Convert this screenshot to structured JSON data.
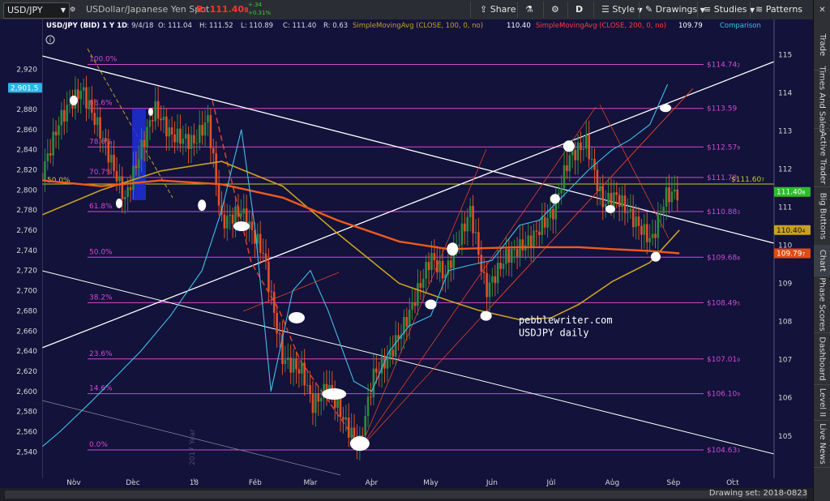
{
  "toolbar": {
    "symbol": "USD/JPY",
    "symbol_desc": "USDollar/Japanese Yen Spot",
    "bid_label": "B: 111.40",
    "bid_sub": "8",
    "change_top": "+.34",
    "change_bottom": "+0.31%",
    "share": "Share",
    "period": "D",
    "style": "Style",
    "drawings": "Drawings",
    "studies": "Studies",
    "patterns": "Patterns"
  },
  "icons": {
    "symbol_dropdown": "chevron-down-icon",
    "share": "share-icon",
    "flask": "flask-icon",
    "gear": "gear-icon",
    "style": "style-icon",
    "drawings": "pencil-icon",
    "studies": "studies-icon",
    "patterns": "patterns-icon",
    "close": "close-icon",
    "info": "info-icon"
  },
  "sidebar": [
    "Trade",
    "Times And Sales",
    "Active Trader",
    "Big Buttons",
    "Chart",
    "Phase Scores",
    "Dashboard",
    "Level II",
    "Live News"
  ],
  "statusbar": {
    "drawing_set": "Drawing set: 2018-0823"
  },
  "colors": {
    "background": "#12123a",
    "price_candle_up": "#2e8b3a",
    "price_candle_down": "#e0502a",
    "sma100": "#c8a21e",
    "sma200": "#f05a1a",
    "cyan_overlay": "#3fc0e8",
    "fib_lines": "#d24ad2",
    "trend_lines": "#ffffff",
    "price_badge": "#2dbb2d"
  },
  "chart_data": {
    "type": "line",
    "header": {
      "title": "USD/JPY (BID) 1 Y 1D",
      "date": "D: 9/4/18",
      "open": "O: 111.04",
      "high": "H: 111.52",
      "low": "L: 110.89",
      "close": "C: 111.40",
      "range": "R: 0.63",
      "sma100_label": "SimpleMovingAvg (CLOSE, 100, 0, no)",
      "sma100_value": "110.40",
      "sma200_label": "SimpleMovingAvg (CLOSE, 200, 0, no)",
      "sma200_value": "109.79",
      "comparison": "Comparison"
    },
    "x_ticks": [
      "Nov",
      "Dec",
      "18",
      "Feb",
      "Mar",
      "Apr",
      "May",
      "Jun",
      "Jul",
      "Aug",
      "Sep",
      "Oct"
    ],
    "right_axis": {
      "ticks": [
        105,
        106,
        107,
        108,
        109,
        110,
        111,
        112,
        113,
        114,
        115
      ],
      "range": [
        104.4,
        115.2
      ]
    },
    "left_axis": {
      "ticks": [
        2540,
        2560,
        2580,
        2600,
        2620,
        2640,
        2660,
        2680,
        2700,
        2720,
        2740,
        2760,
        2780,
        2800,
        2820,
        2840,
        2860,
        2880,
        2900,
        2920
      ],
      "tick_labels": [
        "2,540",
        "2,560",
        "2,580",
        "2,600",
        "2,620",
        "2,640",
        "2,660",
        "2,680",
        "2,700",
        "2,720",
        "2,740",
        "2,760",
        "2,780",
        "2,800",
        "2,820",
        "2,840",
        "2,860",
        "2,880",
        "2,900",
        "2,920"
      ],
      "range": [
        2533,
        2942
      ]
    },
    "fib_levels": [
      {
        "pct": "100.0%",
        "price": "$114.74",
        "price_sub": "2",
        "value": 114.742
      },
      {
        "pct": "88.6%",
        "price": "$113.59",
        "price_sub": "",
        "value": 113.59
      },
      {
        "pct": "78.6%",
        "price": "$112.57",
        "price_sub": "9",
        "value": 112.579
      },
      {
        "pct": "70.7%",
        "price": "$111.78",
        "price_sub": "",
        "value": 111.78
      },
      {
        "pct": "61.8%",
        "price": "$110.88",
        "price_sub": "3",
        "value": 110.883
      },
      {
        "pct": "50.0%",
        "price": "$109.68",
        "price_sub": "8",
        "value": 109.688
      },
      {
        "pct": "38.2%",
        "price": "$108.49",
        "price_sub": "5",
        "value": 108.495
      },
      {
        "pct": "23.6%",
        "price": "$107.01",
        "price_sub": "9",
        "value": 107.019
      },
      {
        "pct": "14.6%",
        "price": "$106.10",
        "price_sub": "9",
        "value": 106.109
      },
      {
        "pct": "0.0%",
        "price": "$104.63",
        "price_sub": "3",
        "value": 104.633
      }
    ],
    "badges": [
      {
        "text": "2,901.5",
        "axis": "left",
        "value": 2901.5,
        "bg": "#29b6e8",
        "fg": "#ffffff"
      },
      {
        "text": "111.40",
        "sub": "8",
        "axis": "right",
        "value": 111.4,
        "bg": "#2dbb2d",
        "fg": "#ffffff"
      },
      {
        "text": "110.40",
        "sub": "4",
        "axis": "right",
        "value": 110.4,
        "bg": "#c8a21e",
        "fg": "#111111"
      },
      {
        "text": "109.79",
        "sub": "7",
        "axis": "right",
        "value": 109.79,
        "bg": "#e24a14",
        "fg": "#ffffff"
      }
    ],
    "horizontal_lines": [
      {
        "label": "50.0%",
        "price_label": "$111.60",
        "price_sub": "7",
        "value": 111.607,
        "color": "#c9c930"
      }
    ],
    "annotations": [
      {
        "text": "pebblewriter.com",
        "x_date": "2018-07-01",
        "y": 107.95
      },
      {
        "text": "USDJPY daily",
        "x_date": "2018-07-01",
        "y": 107.62
      },
      {
        "text": "2017 Year",
        "x_date": "2018-01-01",
        "y": 104.9
      }
    ],
    "series": [
      {
        "name": "SimpleMovingAvg (CLOSE, 100, 0, no)",
        "color": "#c8a21e",
        "x": [
          "2017-10-16",
          "2017-11-15",
          "2017-12-15",
          "2018-01-15",
          "2018-02-15",
          "2018-03-15",
          "2018-04-15",
          "2018-05-10",
          "2018-05-25",
          "2018-06-15",
          "2018-07-01",
          "2018-07-15",
          "2018-08-01",
          "2018-08-20",
          "2018-09-04"
        ],
        "y": [
          110.8,
          111.45,
          111.95,
          112.2,
          111.55,
          110.3,
          109.0,
          108.55,
          108.3,
          108.05,
          108.1,
          108.45,
          109.05,
          109.55,
          110.4
        ]
      },
      {
        "name": "SimpleMovingAvg (CLOSE, 200, 0, no)",
        "color": "#f05a1a",
        "x": [
          "2017-10-16",
          "2017-11-15",
          "2017-12-15",
          "2018-01-15",
          "2018-02-15",
          "2018-03-15",
          "2018-04-15",
          "2018-05-10",
          "2018-06-15",
          "2018-07-15",
          "2018-08-01",
          "2018-08-20",
          "2018-09-04"
        ],
        "y": [
          111.7,
          111.55,
          111.7,
          111.6,
          111.25,
          110.65,
          110.1,
          109.9,
          109.95,
          109.95,
          109.9,
          109.85,
          109.79
        ]
      },
      {
        "name": "Comparison",
        "color": "#3fc0e8",
        "x": [
          "2017-10-16",
          "2017-10-25",
          "2017-11-10",
          "2017-11-25",
          "2017-12-05",
          "2017-12-20",
          "2018-01-05",
          "2018-01-15",
          "2018-01-25",
          "2018-02-01",
          "2018-02-09",
          "2018-02-20",
          "2018-03-01",
          "2018-03-10",
          "2018-03-23",
          "2018-04-01",
          "2018-04-10",
          "2018-04-20",
          "2018-05-01",
          "2018-05-10",
          "2018-05-20",
          "2018-06-01",
          "2018-06-15",
          "2018-06-25",
          "2018-07-05",
          "2018-07-20",
          "2018-08-01",
          "2018-08-10",
          "2018-08-20",
          "2018-08-29"
        ],
        "y": [
          2545,
          2560,
          2590,
          2620,
          2640,
          2675,
          2720,
          2780,
          2860,
          2760,
          2600,
          2700,
          2720,
          2680,
          2610,
          2600,
          2640,
          2665,
          2675,
          2720,
          2725,
          2730,
          2765,
          2770,
          2790,
          2820,
          2840,
          2850,
          2865,
          2905
        ]
      }
    ],
    "price_close": {
      "x": [
        "2017-10-16",
        "2017-10-25",
        "2017-11-05",
        "2017-11-15",
        "2017-11-27",
        "2017-12-05",
        "2017-12-12",
        "2017-12-20",
        "2018-01-01",
        "2018-01-08",
        "2018-01-15",
        "2018-01-25",
        "2018-02-05",
        "2018-02-15",
        "2018-02-25",
        "2018-03-02",
        "2018-03-10",
        "2018-03-20",
        "2018-03-26",
        "2018-04-02",
        "2018-04-10",
        "2018-04-20",
        "2018-05-01",
        "2018-05-08",
        "2018-05-21",
        "2018-05-29",
        "2018-06-08",
        "2018-06-20",
        "2018-07-02",
        "2018-07-10",
        "2018-07-19",
        "2018-07-27",
        "2018-08-03",
        "2018-08-13",
        "2018-08-21",
        "2018-08-28",
        "2018-09-04"
      ],
      "y": [
        111.9,
        113.3,
        114.1,
        112.9,
        111.2,
        112.5,
        113.6,
        112.9,
        112.7,
        113.3,
        110.6,
        110.9,
        109.8,
        107.0,
        106.7,
        105.8,
        106.3,
        105.2,
        104.8,
        106.6,
        107.1,
        108.2,
        109.7,
        109.2,
        110.9,
        108.8,
        109.7,
        110.1,
        110.9,
        112.3,
        112.7,
        111.1,
        111.3,
        110.6,
        110.1,
        111.3,
        111.4
      ]
    }
  }
}
